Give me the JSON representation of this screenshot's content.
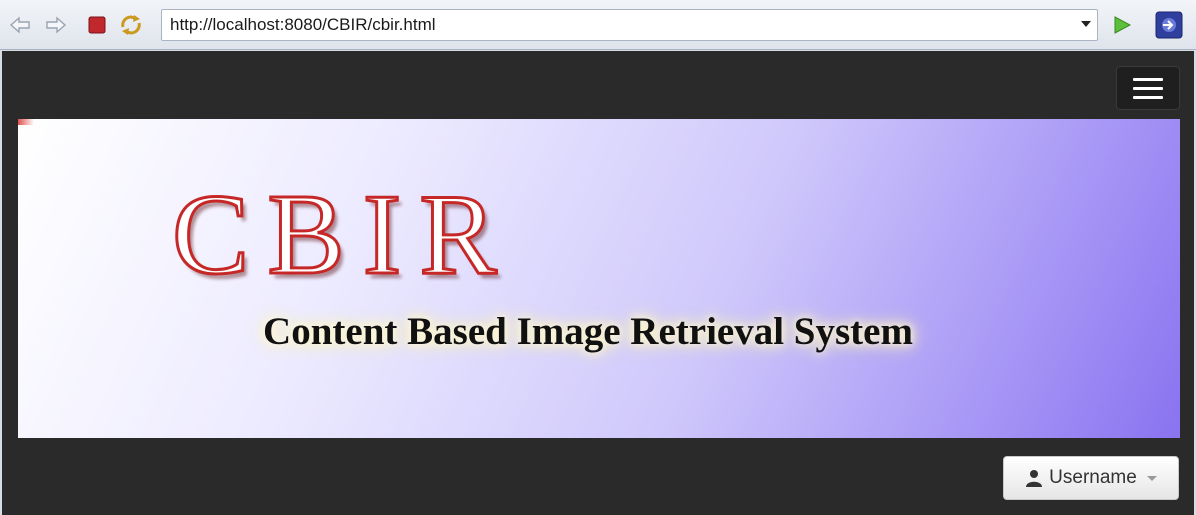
{
  "browser": {
    "url": "http://localhost:8080/CBIR/cbir.html",
    "buttons": [
      "back-icon",
      "forward-icon",
      "stop-icon",
      "refresh-icon",
      "go-icon",
      "launch-icon"
    ]
  },
  "banner": {
    "title": "CBIR",
    "subtitle": "Content Based Image Retrieval System"
  },
  "user_menu": {
    "label": "Username",
    "icon": "user-icon"
  },
  "colors": {
    "page_background": "#2a2a2b",
    "title_stroke": "#c62828",
    "banner_purple": "#8a73f0"
  }
}
